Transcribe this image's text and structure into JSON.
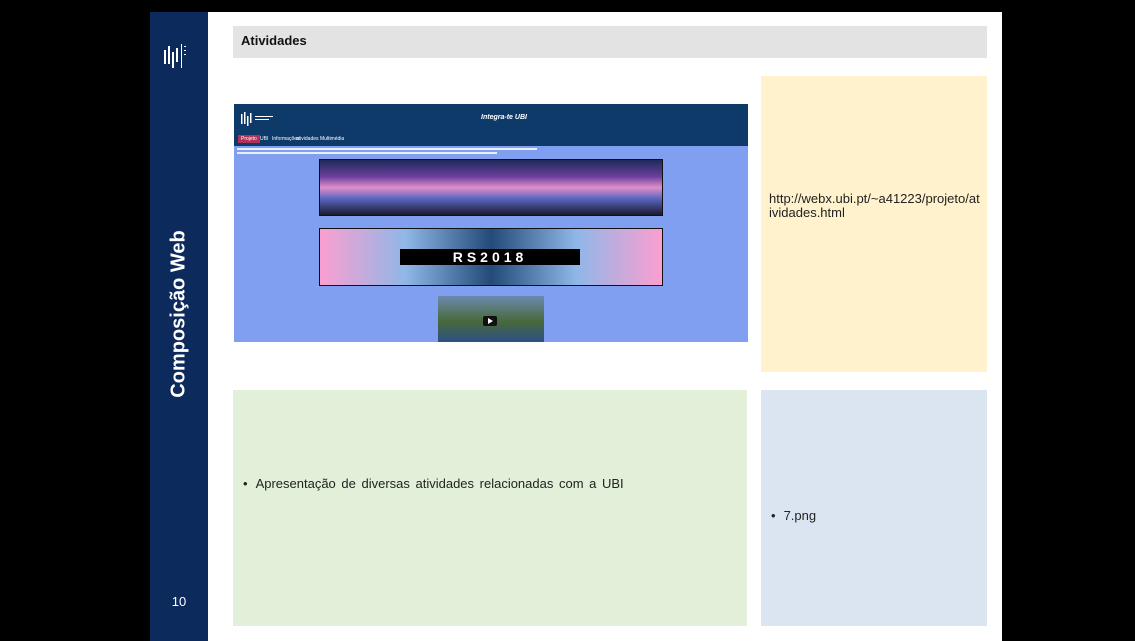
{
  "sidebar": {
    "title": "Composição Web",
    "page_number": "10"
  },
  "header": {
    "title": "Atividades"
  },
  "screenshot": {
    "site_title": "Integra-te UBI",
    "nav": [
      "Projeto",
      "UBI",
      "Informações",
      "atividades",
      "Multimédia"
    ],
    "banner_text": "RS2018"
  },
  "url_box": {
    "text": "http://webx.ubi.pt/~a41223/projeto/atividades.html"
  },
  "description": {
    "bullet": "•",
    "text": "Apresentação de diversas atividades relacionadas com a UBI"
  },
  "file": {
    "bullet": "•",
    "text": "7.png"
  },
  "colors": {
    "sidebar": "#0d2a5c",
    "header_bar": "#e3e3e3",
    "url_box": "#fff2cc",
    "description_box": "#e2efd9",
    "file_box": "#dbe5f1"
  }
}
